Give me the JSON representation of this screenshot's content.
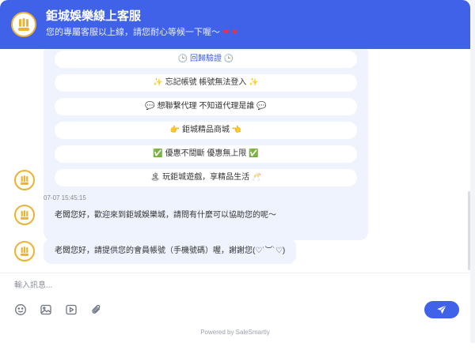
{
  "header": {
    "title": "鉅城娛樂線上客服",
    "subtitle": "您的專屬客服以上線，請您耐心等候一下喔～",
    "hearts": "❤ ❤",
    "logo_text": "鉅城"
  },
  "menu_options": [
    {
      "prefix": "🕒 ",
      "label": "回歸驗證",
      "suffix": " 🕒",
      "is_link": true
    },
    {
      "prefix": "✨ ",
      "label": "忘記帳號 帳號無法登入",
      "suffix": " ✨",
      "is_link": false
    },
    {
      "prefix": "💬 ",
      "label": "想聯繫代理 不知道代理是誰",
      "suffix": " 💬",
      "is_link": false
    },
    {
      "prefix": "👉 ",
      "label": "鉅城精品商城",
      "suffix": " 👈",
      "is_link": false
    },
    {
      "prefix": "✅ ",
      "label": "優惠不間斷 優惠無上限",
      "suffix": " ✅",
      "is_link": false
    },
    {
      "prefix": "🏝 ",
      "label": "玩鉅城遊戲，享精品生活",
      "suffix": " 🥂",
      "is_link": false
    }
  ],
  "messages": [
    {
      "time": "07-07 15:45:15",
      "text": "老闆您好，歡迎來到鉅城娛樂城，請問有什麼可以協助您的呢～"
    },
    {
      "time": "",
      "text": "老闆您好，請提供您的會員帳號（手機號碼）喔，謝謝您(♡˙︶˙♡)"
    }
  ],
  "composer": {
    "placeholder": "輸入訊息...",
    "tools": [
      "emoji-icon",
      "image-icon",
      "video-icon",
      "attachment-icon"
    ],
    "send_icon": "paper-plane-icon"
  },
  "footer": {
    "powered_by": "Powered by SaleSmartly"
  },
  "colors": {
    "brand": "#3f62e9",
    "logo_ring": "#e9b33b",
    "bubble_bg": "#eef3fd"
  }
}
